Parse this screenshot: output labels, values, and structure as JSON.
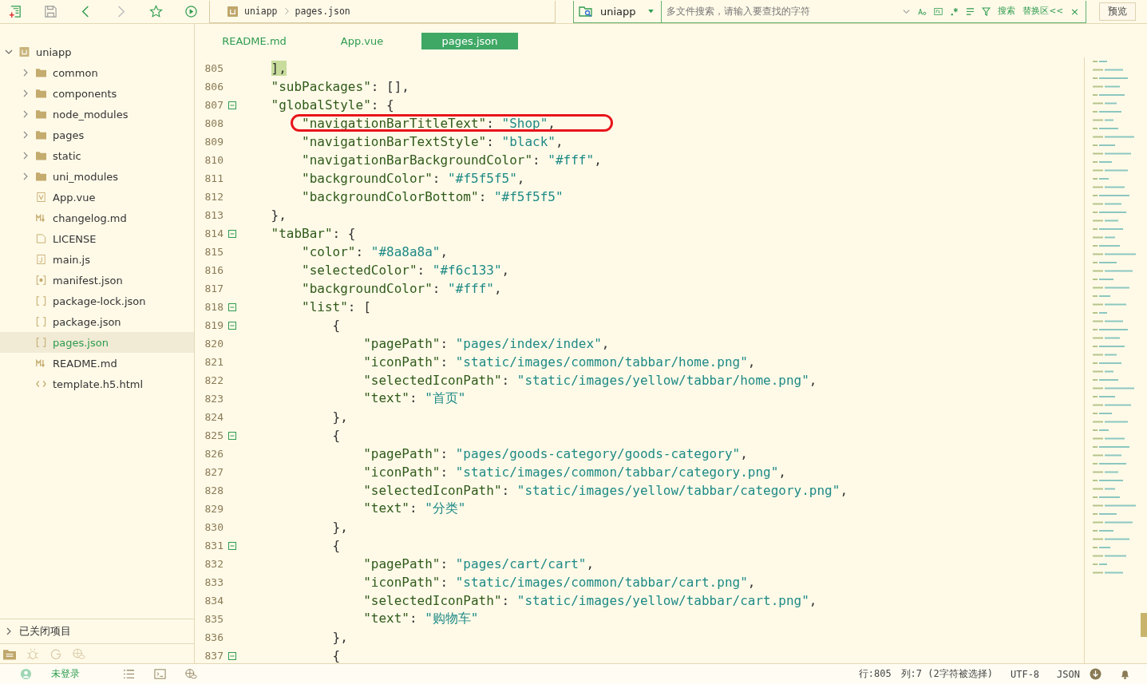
{
  "toolbar": {
    "breadcrumb": [
      "uniapp",
      "pages.json"
    ],
    "search": {
      "scope": "uniapp",
      "placeholder": "多文件搜索，请输入要查找的字符",
      "search_label": "搜索",
      "replace_label": "替换区<<",
      "close": "×"
    },
    "preview_button": "预览"
  },
  "sidebar": {
    "tree": [
      {
        "label": "uniapp",
        "kind": "project",
        "expanded": true,
        "selected": false,
        "children": [
          {
            "label": "common",
            "kind": "folder",
            "expanded": false,
            "selected": false
          },
          {
            "label": "components",
            "kind": "folder",
            "expanded": false,
            "selected": false
          },
          {
            "label": "node_modules",
            "kind": "folder",
            "expanded": false,
            "selected": false
          },
          {
            "label": "pages",
            "kind": "folder",
            "expanded": false,
            "selected": false
          },
          {
            "label": "static",
            "kind": "folder",
            "expanded": false,
            "selected": false
          },
          {
            "label": "uni_modules",
            "kind": "folder",
            "expanded": false,
            "selected": false
          },
          {
            "label": "App.vue",
            "kind": "vue",
            "selected": false
          },
          {
            "label": "changelog.md",
            "kind": "md",
            "selected": false
          },
          {
            "label": "LICENSE",
            "kind": "file",
            "selected": false
          },
          {
            "label": "main.js",
            "kind": "js",
            "selected": false
          },
          {
            "label": "manifest.json",
            "kind": "config",
            "selected": false
          },
          {
            "label": "package-lock.json",
            "kind": "json",
            "selected": false
          },
          {
            "label": "package.json",
            "kind": "json",
            "selected": false
          },
          {
            "label": "pages.json",
            "kind": "json",
            "selected": true
          },
          {
            "label": "README.md",
            "kind": "md",
            "selected": false
          },
          {
            "label": "template.h5.html",
            "kind": "html",
            "selected": false
          }
        ]
      }
    ],
    "closed_projects": {
      "label": "已关闭项目",
      "expanded": false
    }
  },
  "tabs": [
    {
      "label": "README.md",
      "selected": false
    },
    {
      "label": "App.vue",
      "selected": false
    },
    {
      "label": "pages.json",
      "selected": true
    }
  ],
  "editor": {
    "lines": [
      {
        "number": "805",
        "text": "    ],",
        "foldable": false,
        "selected_text": true,
        "annotated": false
      },
      {
        "number": "806",
        "text": "    \"subPackages\": [],",
        "foldable": false,
        "selected_text": false,
        "annotated": false
      },
      {
        "number": "807",
        "text": "    \"globalStyle\": {",
        "foldable": true,
        "selected_text": false,
        "annotated": false
      },
      {
        "number": "808",
        "text": "        \"navigationBarTitleText\": \"Shop\",",
        "foldable": false,
        "selected_text": false,
        "annotated": true
      },
      {
        "number": "809",
        "text": "        \"navigationBarTextStyle\": \"black\",",
        "foldable": false,
        "selected_text": false,
        "annotated": false
      },
      {
        "number": "810",
        "text": "        \"navigationBarBackgroundColor\": \"#fff\",",
        "foldable": false,
        "selected_text": false,
        "annotated": false
      },
      {
        "number": "811",
        "text": "        \"backgroundColor\": \"#f5f5f5\",",
        "foldable": false,
        "selected_text": false,
        "annotated": false
      },
      {
        "number": "812",
        "text": "        \"backgroundColorBottom\": \"#f5f5f5\"",
        "foldable": false,
        "selected_text": false,
        "annotated": false
      },
      {
        "number": "813",
        "text": "    },",
        "foldable": false,
        "selected_text": false,
        "annotated": false
      },
      {
        "number": "814",
        "text": "    \"tabBar\": {",
        "foldable": true,
        "selected_text": false,
        "annotated": false
      },
      {
        "number": "815",
        "text": "        \"color\": \"#8a8a8a\",",
        "foldable": false,
        "selected_text": false,
        "annotated": false
      },
      {
        "number": "816",
        "text": "        \"selectedColor\": \"#f6c133\",",
        "foldable": false,
        "selected_text": false,
        "annotated": false
      },
      {
        "number": "817",
        "text": "        \"backgroundColor\": \"#fff\",",
        "foldable": false,
        "selected_text": false,
        "annotated": false
      },
      {
        "number": "818",
        "text": "        \"list\": [",
        "foldable": true,
        "selected_text": false,
        "annotated": false
      },
      {
        "number": "819",
        "text": "            {",
        "foldable": true,
        "selected_text": false,
        "annotated": false
      },
      {
        "number": "820",
        "text": "                \"pagePath\": \"pages/index/index\",",
        "foldable": false,
        "selected_text": false,
        "annotated": false
      },
      {
        "number": "821",
        "text": "                \"iconPath\": \"static/images/common/tabbar/home.png\",",
        "foldable": false,
        "selected_text": false,
        "annotated": false
      },
      {
        "number": "822",
        "text": "                \"selectedIconPath\": \"static/images/yellow/tabbar/home.png\",",
        "foldable": false,
        "selected_text": false,
        "annotated": false
      },
      {
        "number": "823",
        "text": "                \"text\": \"首页\"",
        "foldable": false,
        "selected_text": false,
        "annotated": false
      },
      {
        "number": "824",
        "text": "            },",
        "foldable": false,
        "selected_text": false,
        "annotated": false
      },
      {
        "number": "825",
        "text": "            {",
        "foldable": true,
        "selected_text": false,
        "annotated": false
      },
      {
        "number": "826",
        "text": "                \"pagePath\": \"pages/goods-category/goods-category\",",
        "foldable": false,
        "selected_text": false,
        "annotated": false
      },
      {
        "number": "827",
        "text": "                \"iconPath\": \"static/images/common/tabbar/category.png\",",
        "foldable": false,
        "selected_text": false,
        "annotated": false
      },
      {
        "number": "828",
        "text": "                \"selectedIconPath\": \"static/images/yellow/tabbar/category.png\",",
        "foldable": false,
        "selected_text": false,
        "annotated": false
      },
      {
        "number": "829",
        "text": "                \"text\": \"分类\"",
        "foldable": false,
        "selected_text": false,
        "annotated": false
      },
      {
        "number": "830",
        "text": "            },",
        "foldable": false,
        "selected_text": false,
        "annotated": false
      },
      {
        "number": "831",
        "text": "            {",
        "foldable": true,
        "selected_text": false,
        "annotated": false
      },
      {
        "number": "832",
        "text": "                \"pagePath\": \"pages/cart/cart\",",
        "foldable": false,
        "selected_text": false,
        "annotated": false
      },
      {
        "number": "833",
        "text": "                \"iconPath\": \"static/images/common/tabbar/cart.png\",",
        "foldable": false,
        "selected_text": false,
        "annotated": false
      },
      {
        "number": "834",
        "text": "                \"selectedIconPath\": \"static/images/yellow/tabbar/cart.png\",",
        "foldable": false,
        "selected_text": false,
        "annotated": false
      },
      {
        "number": "835",
        "text": "                \"text\": \"购物车\"",
        "foldable": false,
        "selected_text": false,
        "annotated": false
      },
      {
        "number": "836",
        "text": "            },",
        "foldable": false,
        "selected_text": false,
        "annotated": false
      },
      {
        "number": "837",
        "text": "            {",
        "foldable": true,
        "selected_text": false,
        "annotated": false
      }
    ]
  },
  "status_bar": {
    "user": "未登录",
    "position": "行:805",
    "column": "列:7 (2字符被选择)",
    "encoding": "UTF-8",
    "language": "JSON"
  }
}
